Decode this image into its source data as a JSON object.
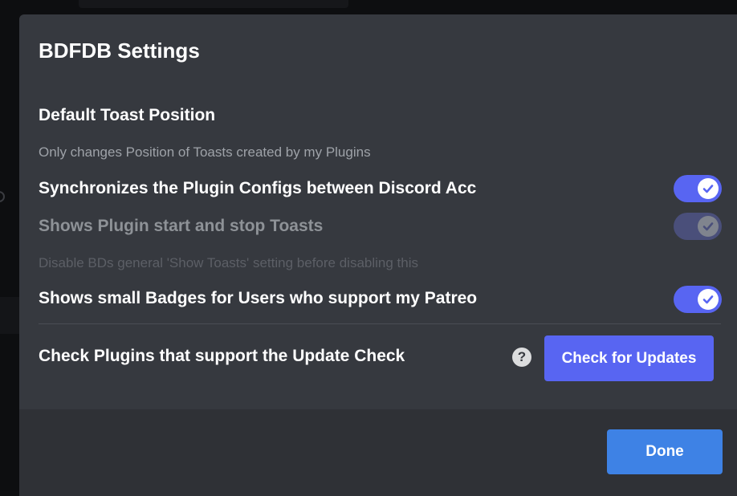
{
  "modal": {
    "title": "BDFDB Settings"
  },
  "toast_section": {
    "title": "Default Toast Position",
    "note": "Only changes Position of Toasts created by my Plugins"
  },
  "settings": [
    {
      "label": "Synchronizes the Plugin Configs between Discord Acc",
      "enabled": true,
      "disabled": false
    },
    {
      "label": "Shows Plugin start and stop Toasts",
      "enabled": true,
      "disabled": true,
      "note": "Disable BDs general 'Show Toasts' setting before disabling this"
    },
    {
      "label": "Shows small Badges for Users who support my Patreo",
      "enabled": true,
      "disabled": false
    }
  ],
  "update_check": {
    "label": "Check Plugins that support the Update Check",
    "help_icon": "?",
    "button_label": "Check for Updates"
  },
  "footer": {
    "done_label": "Done"
  },
  "colors": {
    "modal_bg": "#36393f",
    "footer_bg": "#2f3136",
    "accent": "#5865f2",
    "done_button": "#3e82e5"
  }
}
